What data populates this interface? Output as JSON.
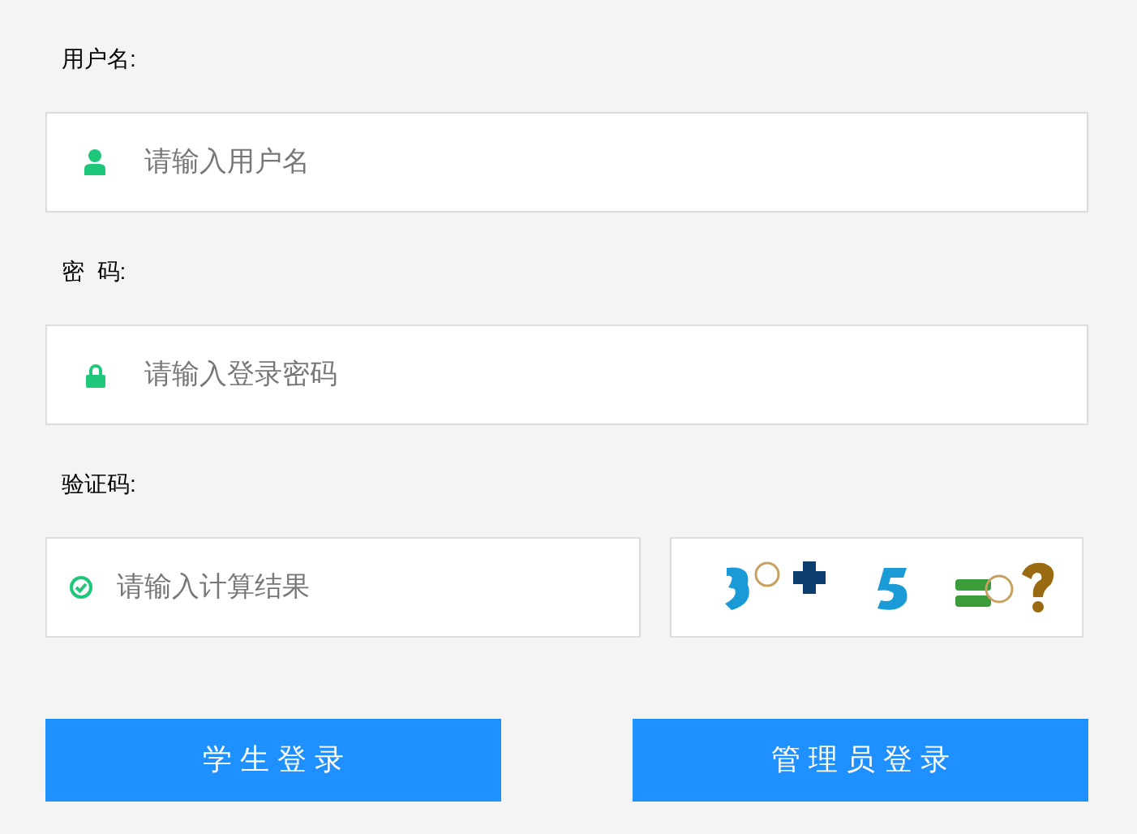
{
  "username": {
    "label": "用户名:",
    "placeholder": "请输入用户名"
  },
  "password": {
    "label": "密  码:",
    "placeholder": "请输入登录密码"
  },
  "captcha": {
    "label": "验证码:",
    "placeholder": "请输入计算结果"
  },
  "buttons": [
    "学 生 登 录",
    "管 理 员 登 录"
  ]
}
